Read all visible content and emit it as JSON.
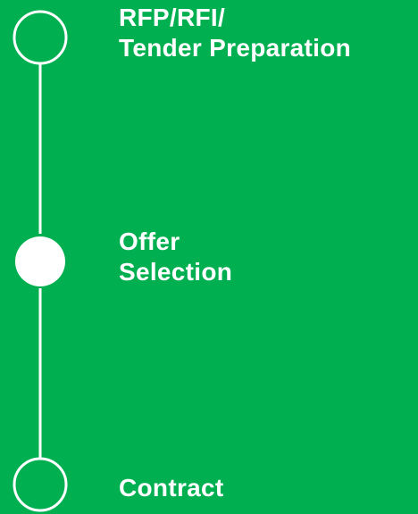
{
  "colors": {
    "background": "#00b050",
    "foreground": "#ffffff"
  },
  "steps": [
    {
      "lines": [
        "RFP/RFI/",
        "Tender Preparation"
      ],
      "state": "outline",
      "icon": "circle-outline-icon"
    },
    {
      "lines": [
        "Offer",
        "Selection"
      ],
      "state": "filled",
      "icon": "circle-filled-icon"
    },
    {
      "lines": [
        "Contract"
      ],
      "state": "outline",
      "icon": "circle-outline-icon"
    }
  ]
}
